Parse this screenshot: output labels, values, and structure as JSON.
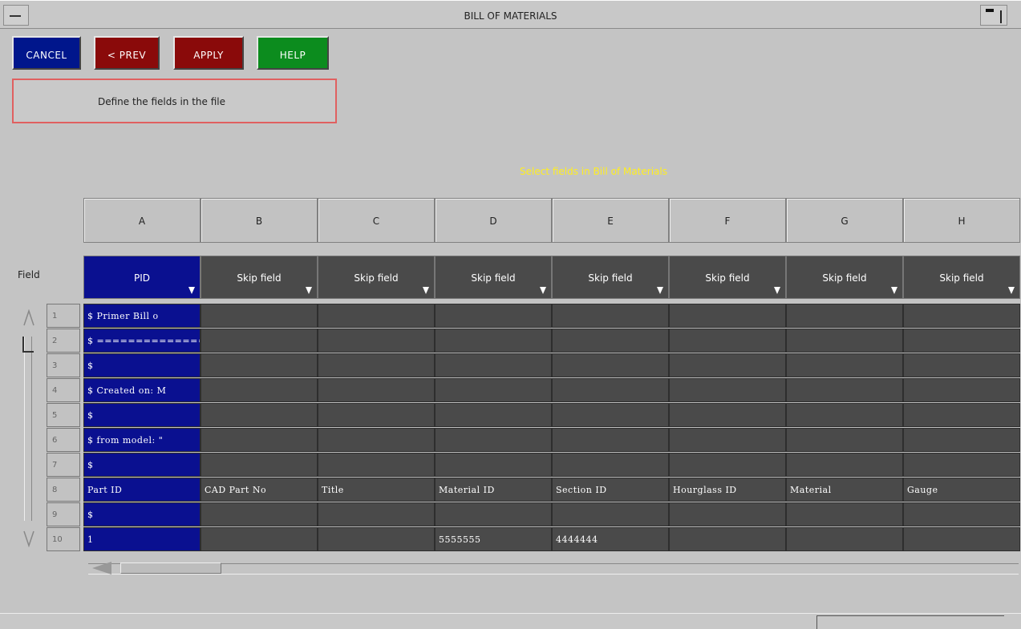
{
  "window": {
    "title": "BILL OF MATERIALS"
  },
  "toolbar": {
    "cancel": "CANCEL",
    "prev": "< PREV",
    "apply": "APPLY",
    "help": "HELP"
  },
  "message": "Define the fields in the file",
  "select_title": "Select fields in Bill of Materials",
  "field_label": "Field",
  "columns": [
    "A",
    "B",
    "C",
    "D",
    "E",
    "F",
    "G",
    "H"
  ],
  "fields": [
    "PID",
    "Skip field",
    "Skip field",
    "Skip field",
    "Skip field",
    "Skip field",
    "Skip field",
    "Skip field"
  ],
  "rows": [
    {
      "num": "1",
      "cells": [
        "$ Primer Bill o",
        "",
        "",
        "",
        "",
        "",
        "",
        ""
      ]
    },
    {
      "num": "2",
      "cells": [
        "$ ==============",
        "",
        "",
        "",
        "",
        "",
        "",
        ""
      ]
    },
    {
      "num": "3",
      "cells": [
        "$",
        "",
        "",
        "",
        "",
        "",
        "",
        ""
      ]
    },
    {
      "num": "4",
      "cells": [
        "$ Created on: M",
        "",
        "",
        "",
        "",
        "",
        "",
        ""
      ]
    },
    {
      "num": "5",
      "cells": [
        "$",
        "",
        "",
        "",
        "",
        "",
        "",
        ""
      ]
    },
    {
      "num": "6",
      "cells": [
        "$ from model: \"",
        "",
        "",
        "",
        "",
        "",
        "",
        ""
      ]
    },
    {
      "num": "7",
      "cells": [
        "$",
        "",
        "",
        "",
        "",
        "",
        "",
        ""
      ]
    },
    {
      "num": "8",
      "cells": [
        "Part ID",
        "CAD Part No",
        "Title",
        "Material ID",
        "Section ID",
        "Hourglass ID",
        "Material",
        "Gauge"
      ]
    },
    {
      "num": "9",
      "cells": [
        "$",
        "",
        "",
        "",
        "",
        "",
        "",
        ""
      ]
    },
    {
      "num": "10",
      "cells": [
        "1",
        "",
        "",
        "5555555",
        "4444444",
        "",
        "",
        ""
      ]
    }
  ],
  "colors": {
    "cancel": "#00168c",
    "prev": "#8a0a0a",
    "apply": "#8a0a0a",
    "help": "#0c8c1e",
    "selected": "#0a1090",
    "cell": "#4a4a4a"
  }
}
